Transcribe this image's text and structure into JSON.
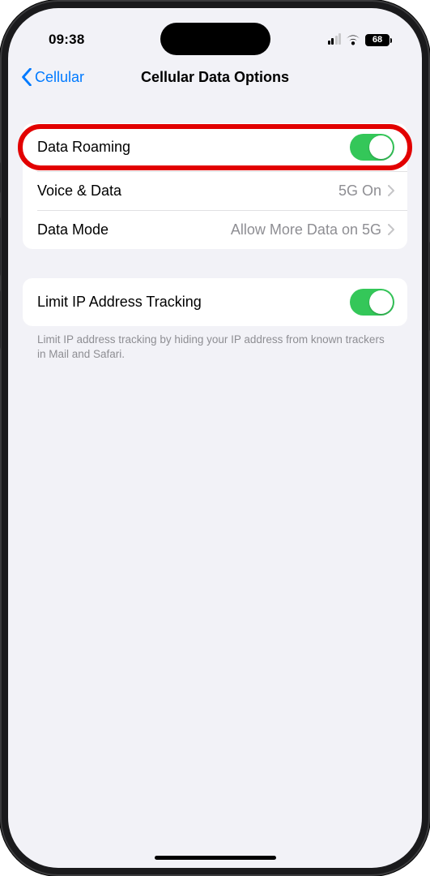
{
  "status": {
    "time": "09:38",
    "battery_pct": "68"
  },
  "nav": {
    "back_label": "Cellular",
    "title": "Cellular Data Options"
  },
  "group1": {
    "row1": {
      "label": "Data Roaming"
    },
    "row2": {
      "label": "Voice & Data",
      "value": "5G On"
    },
    "row3": {
      "label": "Data Mode",
      "value": "Allow More Data on 5G"
    }
  },
  "group2": {
    "row1": {
      "label": "Limit IP Address Tracking"
    },
    "footer": "Limit IP address tracking by hiding your IP address from known trackers in Mail and Safari."
  }
}
